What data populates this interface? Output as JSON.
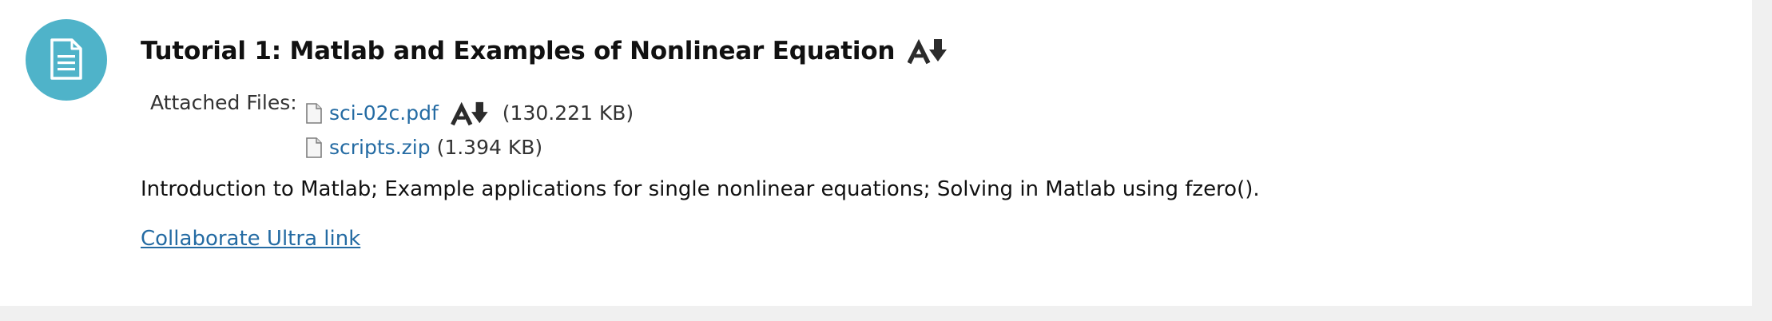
{
  "item": {
    "title": "Tutorial 1: Matlab and Examples of Nonlinear Equation",
    "icon": "document-icon",
    "accent_color": "#4fb3c9",
    "title_accessibility_icon": "ally-alternative-formats-icon"
  },
  "attachments": {
    "label": "Attached Files:",
    "files": [
      {
        "name": "sci-02c.pdf",
        "size": "(130.221 KB)",
        "icon": "file-icon",
        "has_accessibility_icon": true
      },
      {
        "name": "scripts.zip",
        "size": "(1.394 KB)",
        "icon": "file-icon",
        "has_accessibility_icon": false
      }
    ]
  },
  "description": "Introduction to Matlab; Example applications for single nonlinear equations; Solving in Matlab using fzero().",
  "link": {
    "label": "Collaborate Ultra link",
    "color": "#246ba3"
  }
}
